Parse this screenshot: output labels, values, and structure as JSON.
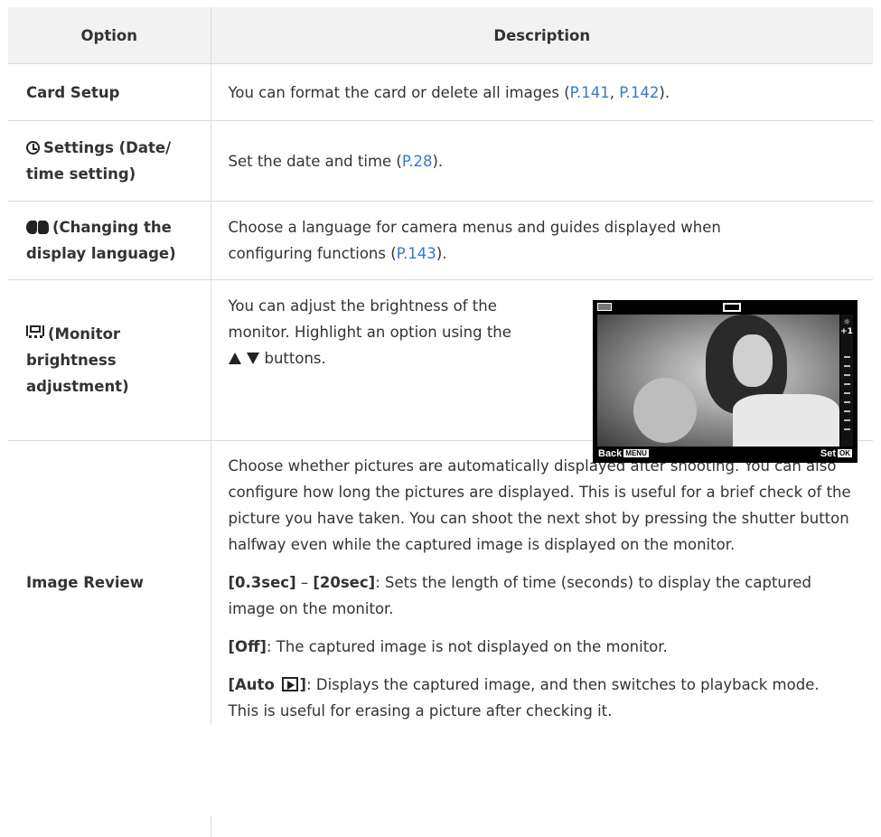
{
  "table": {
    "headers": {
      "option": "Option",
      "description": "Description"
    },
    "rows": {
      "card": {
        "option": "Card Setup",
        "desc_pre": "You can format the card or delete all images (",
        "link1": "P.141",
        "sep": ", ",
        "link2": "P.142",
        "desc_post": ")."
      },
      "date": {
        "option_a": "Settings (Date/",
        "option_b": "time setting)",
        "desc_pre": "Set the date and time (",
        "link": "P.28",
        "desc_post": ")."
      },
      "lang": {
        "option_a": "(Changing the",
        "option_b": "display language)",
        "desc_a": "Choose a language for camera menus and guides displayed when",
        "desc_b": "configuring functions (",
        "link": "P.143",
        "desc_post": ")."
      },
      "monitor": {
        "option_a": "(Monitor",
        "option_b": "brightness",
        "option_c": "adjustment)",
        "desc_a": "You can adjust the brightness of the",
        "desc_b": "monitor. Highlight an option using the",
        "desc_c": "buttons.",
        "screen": {
          "level": "+1",
          "back_label": "Back",
          "back_tag": "MENU",
          "set_label": "Set",
          "set_tag": "OK"
        }
      },
      "review": {
        "option": "Image Review",
        "p1": "Choose whether pictures are automatically displayed after shooting. You can also configure how long the pictures are displayed. This is useful for a brief check of the picture you have taken. You can shoot the next shot by pressing the shutter button halfway even while the captured image is displayed on the monitor.",
        "p2_bold": "[0.3sec]",
        "p2_dash": " – ",
        "p2_bold2": "[20sec]",
        "p2_rest": ": Sets the length of time (seconds) to display the captured image on the monitor.",
        "p3_bold": "[Off]",
        "p3_rest": ": The captured image is not displayed on the monitor.",
        "p4_bold_a": "[Auto ",
        "p4_bold_b": "]",
        "p4_rest": ": Displays the captured image, and then switches to playback mode. This is useful for erasing a picture after checking it."
      }
    }
  },
  "colors": {
    "link": "#2f7bd8",
    "header_bg": "#f2f2f2",
    "border": "#dadada",
    "text": "#333333"
  }
}
